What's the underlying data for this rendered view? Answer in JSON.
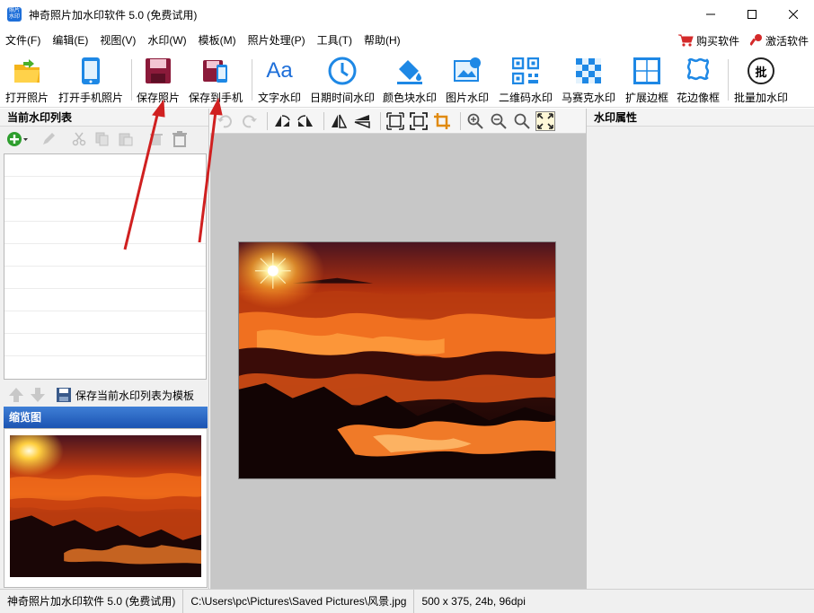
{
  "window": {
    "title": "神奇照片加水印软件 5.0 (免费试用)",
    "icon_text": "照片 水印"
  },
  "menu": {
    "items": [
      "文件(F)",
      "编辑(E)",
      "视图(V)",
      "水印(W)",
      "模板(M)",
      "照片处理(P)",
      "工具(T)",
      "帮助(H)"
    ],
    "buy": "购买软件",
    "activate": "激活软件"
  },
  "toolbar": {
    "buttons": [
      {
        "label": "打开照片",
        "icon": "open-folder-icon"
      },
      {
        "label": "打开手机照片",
        "icon": "phone-icon"
      },
      {
        "label": "保存照片",
        "icon": "save-disk-icon"
      },
      {
        "label": "保存到手机",
        "icon": "save-to-phone-icon"
      },
      {
        "label": "文字水印",
        "icon": "text-aa-icon",
        "glyph": "Aa"
      },
      {
        "label": "日期时间水印",
        "icon": "clock-icon"
      },
      {
        "label": "颜色块水印",
        "icon": "paint-bucket-icon"
      },
      {
        "label": "图片水印",
        "icon": "picture-icon"
      },
      {
        "label": "二维码水印",
        "icon": "qrcode-icon"
      },
      {
        "label": "马赛克水印",
        "icon": "mosaic-icon"
      },
      {
        "label": "扩展边框",
        "icon": "expand-border-icon"
      },
      {
        "label": "花边像框",
        "icon": "lace-frame-icon"
      },
      {
        "label": "批量加水印",
        "icon": "batch-icon",
        "glyph": "批"
      }
    ]
  },
  "left_panel": {
    "title": "当前水印列表",
    "save_template": "保存当前水印列表为模板",
    "thumbnail_title": "缩览图"
  },
  "right_panel": {
    "title": "水印属性"
  },
  "status": {
    "app": "神奇照片加水印软件 5.0 (免费试用)",
    "path": "C:\\Users\\pc\\Pictures\\Saved Pictures\\风景.jpg",
    "info": "500 x 375, 24b, 96dpi"
  },
  "colors": {
    "accent_blue": "#1e6fd9",
    "save_red": "#8b1a3a",
    "thumb_header": "#2a63c0",
    "arrow": "#d02020"
  }
}
